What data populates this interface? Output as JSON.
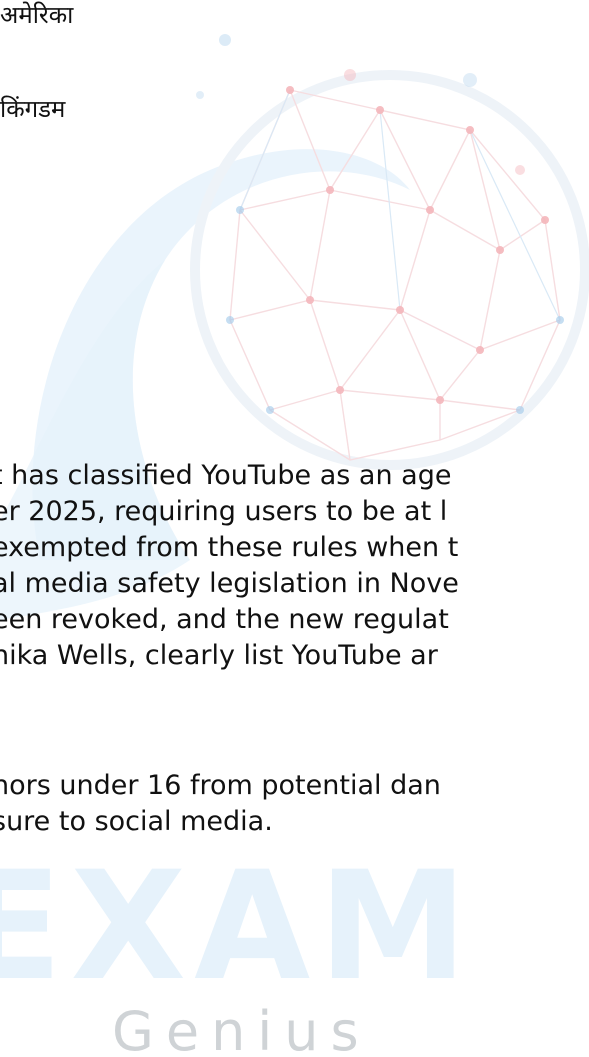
{
  "options": [
    "अमेरिका",
    "किंगडम"
  ],
  "paragraph_1": [
    "t has classified YouTube as an age",
    "er 2025, requiring users to be at l",
    "exempted from these rules when t",
    "al media safety legislation in Nove",
    "een revoked, and the new regulat",
    "nika Wells, clearly list YouTube ar"
  ],
  "paragraph_2": [
    "nors under 16 from potential dan",
    "sure to social media."
  ],
  "watermark": {
    "brand_word": "EXAM",
    "brand_sub": "Genius",
    "color_light": "#e6f2fb",
    "color_sub": "#cfd3d6",
    "accent_red": "#f4b6bb",
    "accent_blue": "#9fc8ea"
  }
}
